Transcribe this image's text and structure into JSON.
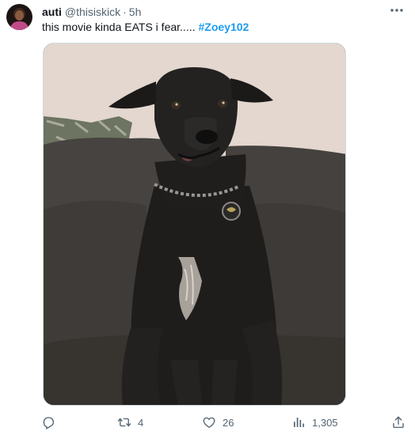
{
  "author": {
    "name": "auti",
    "handle": "@thisiskick",
    "separator": "·",
    "time": "5h"
  },
  "tweet": {
    "text": "this movie kinda EATS i fear.....",
    "hashtag": "#Zoey102"
  },
  "media": {
    "description_icon": "photo"
  },
  "actions": {
    "reply_icon": "reply-icon",
    "retweet_count": "4",
    "like_count": "26",
    "views_count": "1,305",
    "share_icon": "share-icon"
  },
  "colors": {
    "link": "#1d9bf0",
    "muted": "#536471",
    "text": "#0f1419"
  }
}
